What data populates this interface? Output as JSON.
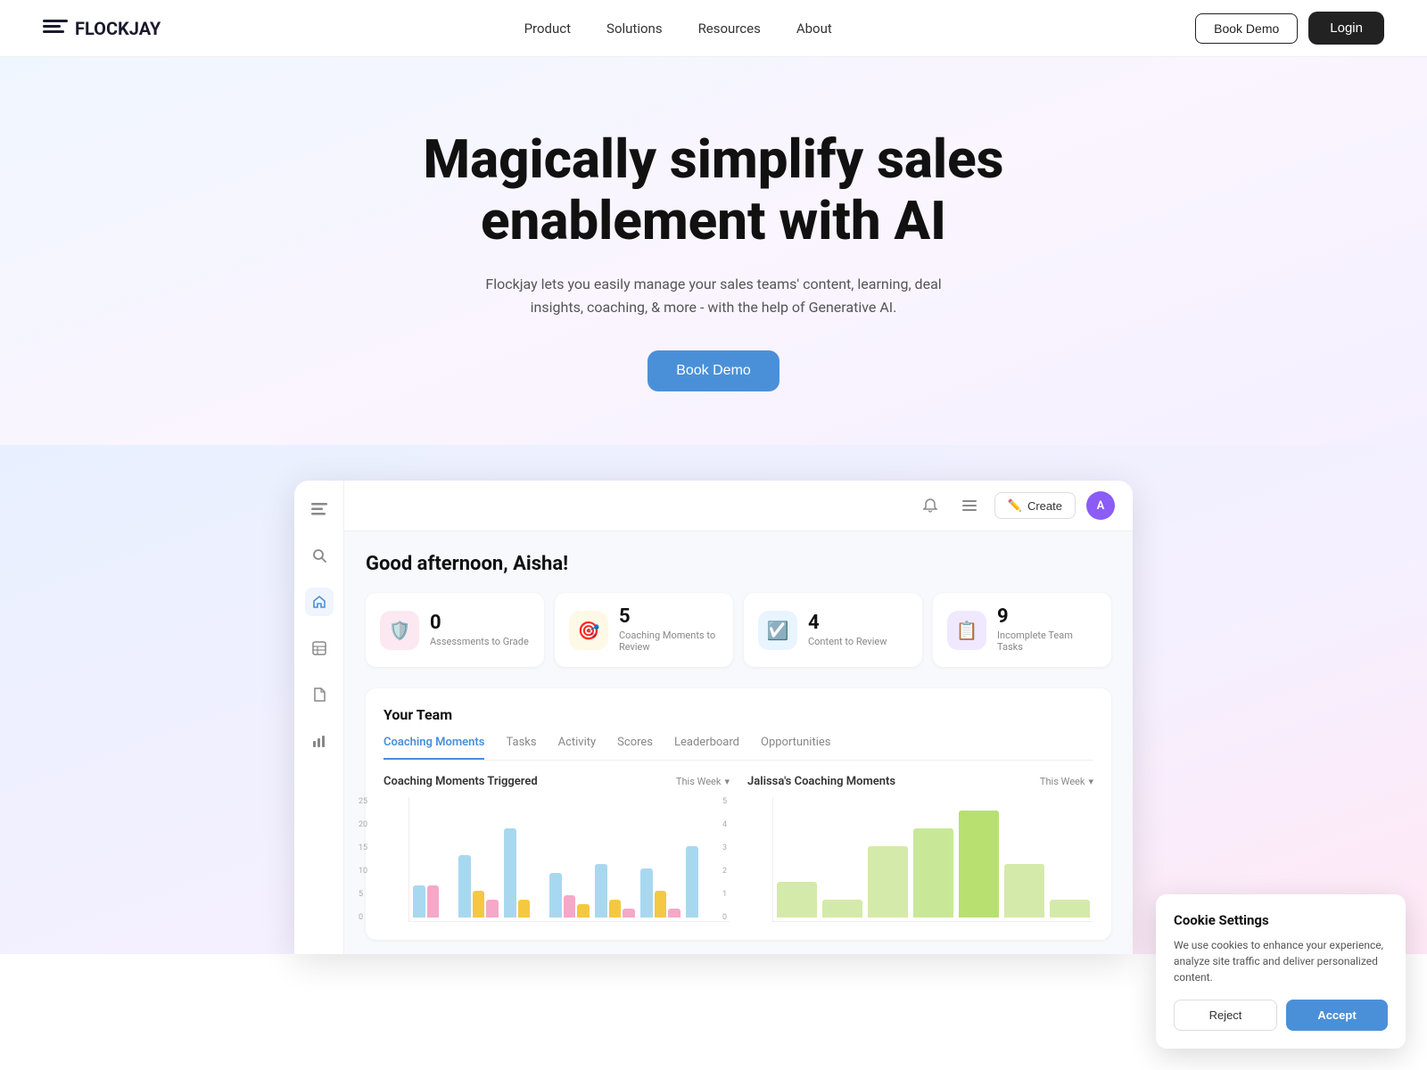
{
  "nav": {
    "logo_text": "FLOCKJAY",
    "links": [
      "Product",
      "Solutions",
      "Resources",
      "About"
    ],
    "book_demo": "Book Demo",
    "login": "Login"
  },
  "hero": {
    "headline_line1": "Magically simplify sales",
    "headline_line2": "enablement with AI",
    "subtext": "Flockjay lets you easily manage your sales teams' content, learning, deal insights, coaching, & more - with the help of Generative AI.",
    "cta": "Book Demo"
  },
  "app": {
    "topbar": {
      "create_label": "Create"
    },
    "greeting": "Good afternoon, Aisha!",
    "stats": [
      {
        "id": "assessments",
        "value": "0",
        "label": "Assessments to Grade",
        "icon": "🛡",
        "color": "pink"
      },
      {
        "id": "coaching",
        "value": "5",
        "label": "Coaching Moments to Review",
        "icon": "🎯",
        "color": "yellow"
      },
      {
        "id": "content",
        "value": "4",
        "label": "Content to Review",
        "icon": "☑",
        "color": "blue"
      },
      {
        "id": "tasks",
        "value": "9",
        "label": "Incomplete Team Tasks",
        "icon": "≡",
        "color": "purple"
      }
    ],
    "team_section": {
      "title": "Your Team",
      "tabs": [
        "Coaching Moments",
        "Tasks",
        "Activity",
        "Scores",
        "Leaderboard",
        "Opportunities"
      ],
      "active_tab": "Coaching Moments",
      "chart1": {
        "title": "Coaching Moments Triggered",
        "filter": "This Week"
      },
      "chart2": {
        "title": "Jalissa's Coaching Moments",
        "filter": "This Week"
      }
    }
  },
  "cookie": {
    "title": "Cookie Settings",
    "text": "We use cookies to enhance your experience, analyze site traffic and deliver personalized content.",
    "reject": "Reject",
    "accept": "Accept"
  }
}
